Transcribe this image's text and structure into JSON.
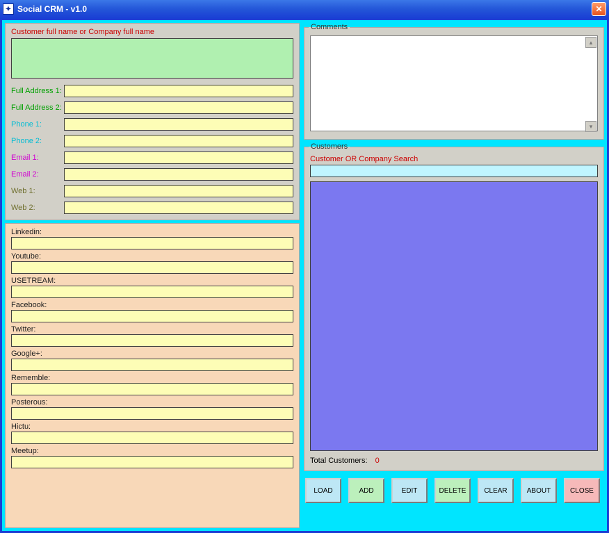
{
  "window": {
    "title": "Social CRM - v1.0"
  },
  "contact": {
    "name_label": "Customer full name or Company full name",
    "name_value": "",
    "addr1_label": "Full Address 1:",
    "addr1_value": "",
    "addr2_label": "Full Address 2:",
    "addr2_value": "",
    "phone1_label": "Phone 1:",
    "phone1_value": "",
    "phone2_label": "Phone 2:",
    "phone2_value": "",
    "email1_label": "Email 1:",
    "email1_value": "",
    "email2_label": "Email 2:",
    "email2_value": "",
    "web1_label": "Web 1:",
    "web1_value": "",
    "web2_label": "Web 2:",
    "web2_value": ""
  },
  "social": {
    "linkedin_label": "Linkedin:",
    "linkedin_value": "",
    "youtube_label": "Youtube:",
    "youtube_value": "",
    "ustream_label": "USETREAM:",
    "ustream_value": "",
    "facebook_label": "Facebook:",
    "facebook_value": "",
    "twitter_label": "Twitter:",
    "twitter_value": "",
    "googleplus_label": "Google+:",
    "googleplus_value": "",
    "rememble_label": "Rememble:",
    "rememble_value": "",
    "posterous_label": "Posterous:",
    "posterous_value": "",
    "hictu_label": "Hictu:",
    "hictu_value": "",
    "meetup_label": "Meetup:",
    "meetup_value": ""
  },
  "comments": {
    "legend": "Comments",
    "value": ""
  },
  "customers": {
    "legend": "Customers",
    "search_label": "Customer OR Company Search",
    "search_value": "",
    "total_label": "Total Customers:",
    "total_count": "0"
  },
  "buttons": {
    "load": "LOAD",
    "add": "ADD",
    "edit": "EDIT",
    "delete": "DELETE",
    "clear": "CLEAR",
    "about": "ABOUT",
    "close": "CLOSE"
  }
}
